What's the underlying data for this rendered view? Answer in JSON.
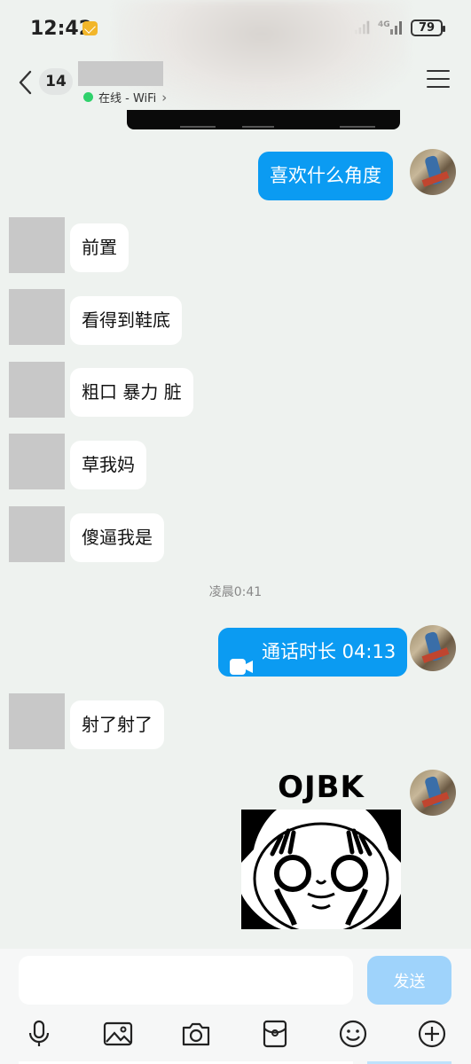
{
  "status_bar": {
    "time": "12:42",
    "network": "4G",
    "battery": "79"
  },
  "header": {
    "unread_count": "14",
    "presence": "在线 - WiFi",
    "presence_chevron": "›"
  },
  "messages": {
    "m1": "喜欢什么角度",
    "m2": "前置",
    "m3": "看得到鞋底",
    "m4": "粗口 暴力 脏",
    "m5": "草我妈",
    "m6": "傻逼我是",
    "timestamp": "凌晨0:41",
    "call_label": "通话时长 04:13",
    "m8": "射了射了",
    "sticker_text": "OJBK"
  },
  "input": {
    "placeholder": "",
    "send_label": "发送"
  },
  "icons": [
    "back-icon",
    "menu-icon",
    "mic-icon",
    "image-icon",
    "camera-icon",
    "red-packet-icon",
    "emoji-icon",
    "plus-icon",
    "video-call-icon"
  ],
  "colors": {
    "outgoing_bubble": "#0b9bf2",
    "send_button": "#9fd3fb",
    "online_dot": "#2fd16b",
    "background": "#eef2ef"
  }
}
